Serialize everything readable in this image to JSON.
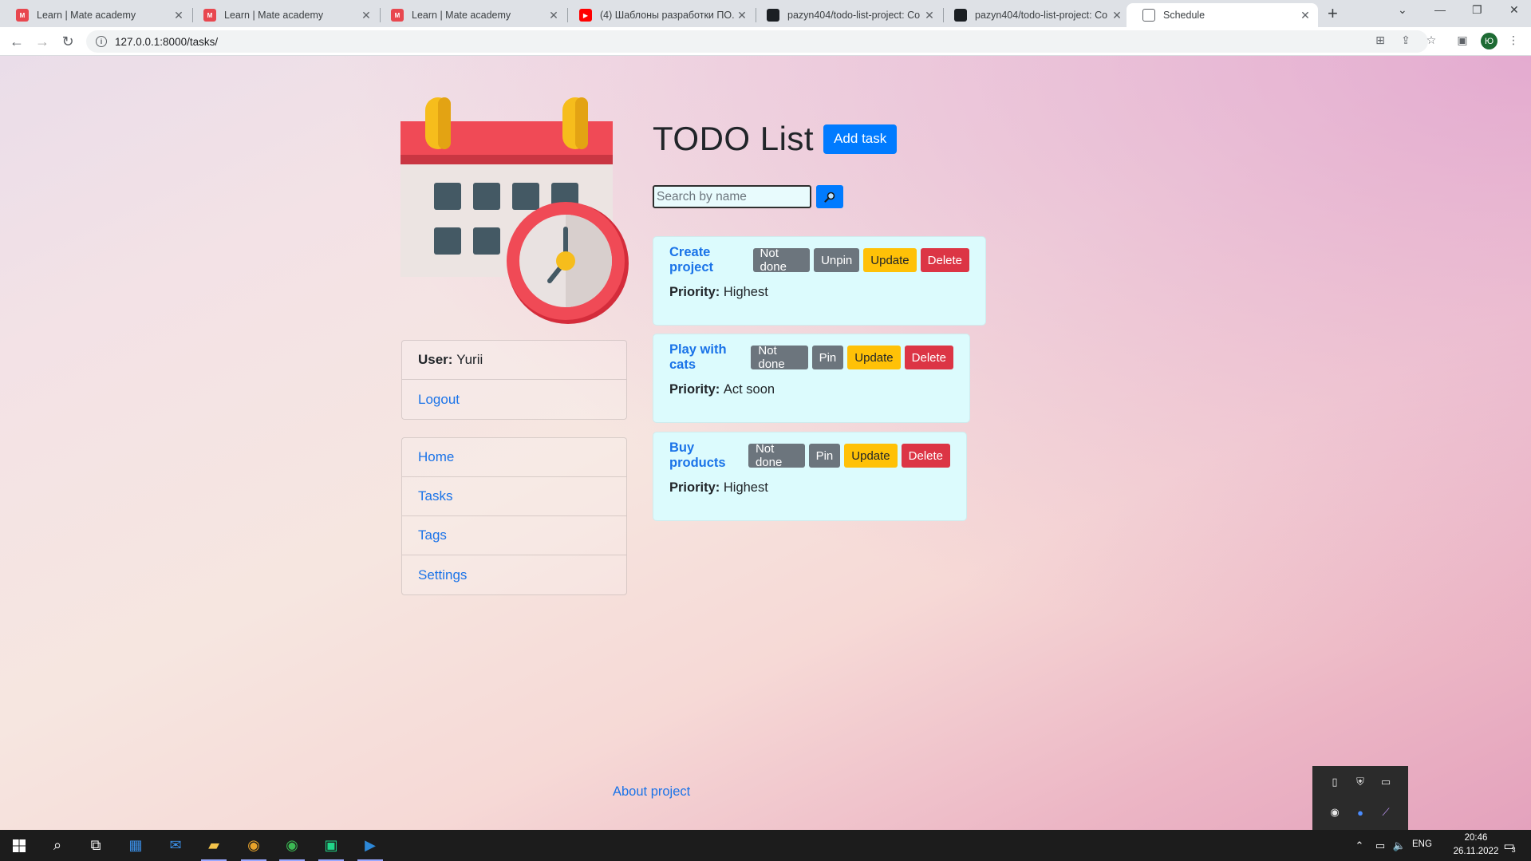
{
  "browser": {
    "tabs": [
      {
        "title": "Learn | Mate academy",
        "icon": "mate-academy-icon",
        "active": false
      },
      {
        "title": "Learn | Mate academy",
        "icon": "mate-academy-icon",
        "active": false
      },
      {
        "title": "Learn | Mate academy",
        "icon": "mate-academy-icon",
        "active": false
      },
      {
        "title": "(4) Шаблоны разработки ПО. U",
        "icon": "youtube-icon",
        "active": false
      },
      {
        "title": "pazyn404/todo-list-project: Co",
        "icon": "github-icon",
        "active": false
      },
      {
        "title": "pazyn404/todo-list-project: Co",
        "icon": "github-icon",
        "active": false
      },
      {
        "title": "Schedule",
        "icon": "globe-icon",
        "active": true
      }
    ],
    "url": "127.0.0.1:8000/tasks/",
    "profile_initial": "Ю"
  },
  "sidebar": {
    "user_label": "User:",
    "user_name": "Yurii",
    "logout": "Logout",
    "nav": [
      {
        "label": "Home"
      },
      {
        "label": "Tasks"
      },
      {
        "label": "Tags"
      },
      {
        "label": "Settings"
      }
    ]
  },
  "main": {
    "title": "TODO List",
    "add_task": "Add task",
    "search_placeholder": "Search by name",
    "priority_label": "Priority:",
    "tasks": [
      {
        "name": "Create project",
        "status_btn": "Not done",
        "pin_btn": "Unpin",
        "update_btn": "Update",
        "delete_btn": "Delete",
        "priority": "Highest"
      },
      {
        "name": "Play with cats",
        "status_btn": "Not done",
        "pin_btn": "Pin",
        "update_btn": "Update",
        "delete_btn": "Delete",
        "priority": "Act soon"
      },
      {
        "name": "Buy products",
        "status_btn": "Not done",
        "pin_btn": "Pin",
        "update_btn": "Update",
        "delete_btn": "Delete",
        "priority": "Highest"
      }
    ]
  },
  "footer": {
    "about": "About project"
  },
  "taskbar": {
    "language": "ENG",
    "time": "20:46",
    "date": "26.11.2022",
    "notifications": "3"
  },
  "colors": {
    "primary": "#007bff",
    "secondary": "#6c757d",
    "warning": "#ffc107",
    "danger": "#dc3545",
    "link": "#1a73e8",
    "task_bg": "#dcfbfd"
  }
}
